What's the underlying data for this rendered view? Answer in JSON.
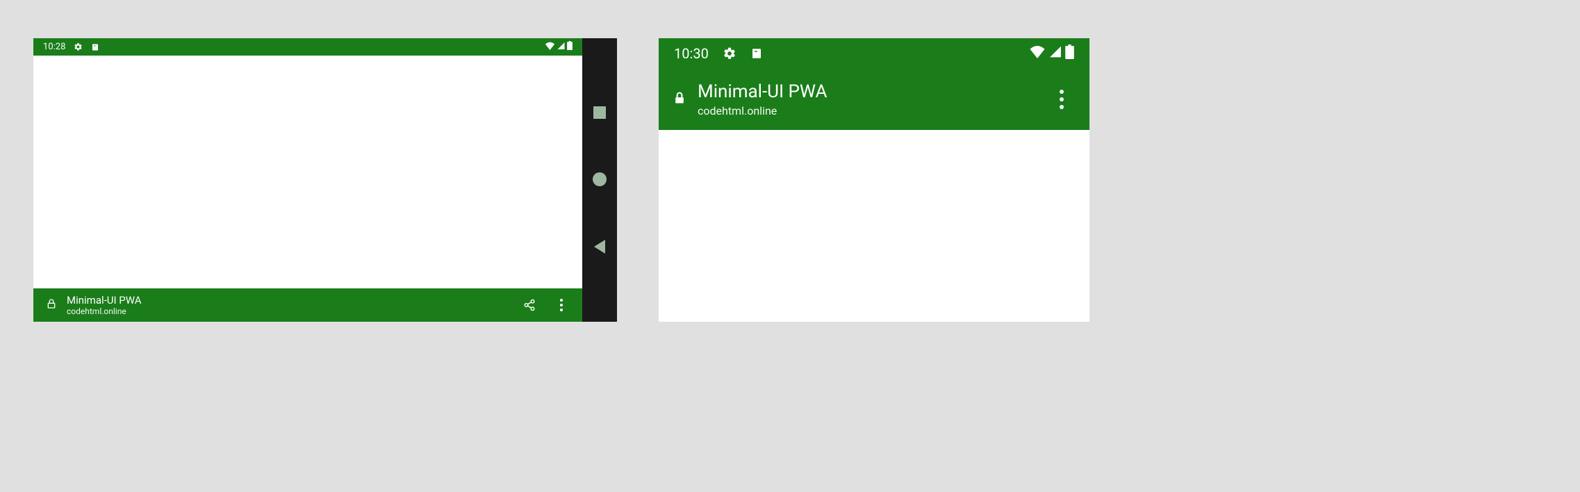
{
  "left": {
    "status_time": "10:28",
    "app_title": "Minimal-UI PWA",
    "app_host": "codehtml.online"
  },
  "right": {
    "status_time": "10:30",
    "app_title": "Minimal-UI PWA",
    "app_host": "codehtml.online"
  }
}
